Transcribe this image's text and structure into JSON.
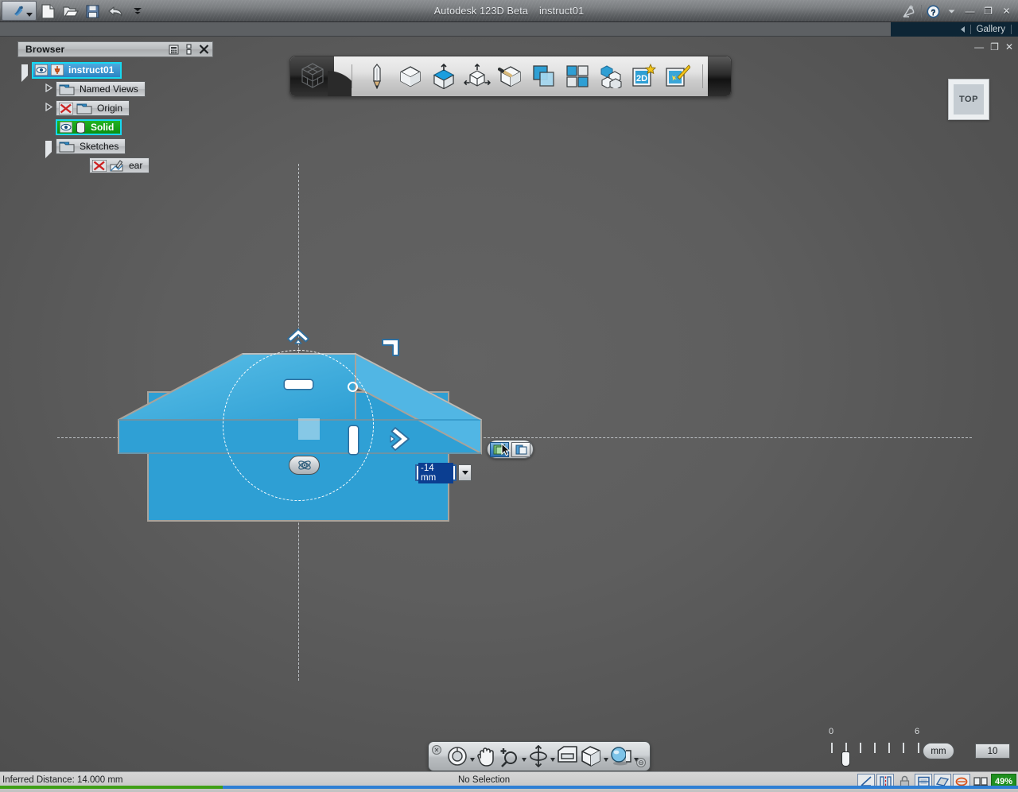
{
  "window": {
    "app_title": "Autodesk 123D Beta",
    "document_name": "instruct01",
    "app_button_icon": "autodesk-logo-icon",
    "app_button_caret_icon": "chevron-down-icon",
    "quick_access": [
      {
        "name": "new-document",
        "icon": "new-file-icon"
      },
      {
        "name": "open-document",
        "icon": "open-folder-icon"
      },
      {
        "name": "save-document",
        "icon": "floppy-disk-icon"
      },
      {
        "name": "undo",
        "icon": "undo-arrow-icon"
      },
      {
        "name": "customize-quick-access",
        "icon": "chevron-down-icon"
      }
    ],
    "help_icon": "question-mark-icon",
    "signal_icon": "satellite-dish-icon",
    "help_caret_icon": "chevron-down-icon",
    "minimize_label": "—",
    "restore_label": "❐",
    "close_label": "✕"
  },
  "gallery_bar": {
    "label": "Gallery",
    "collapse_icon": "triangle-left-icon"
  },
  "browser": {
    "title": "Browser",
    "header_icons": [
      {
        "name": "filter-icon",
        "glyph": "▒"
      },
      {
        "name": "dock-icon",
        "glyph": "▂"
      },
      {
        "name": "close-panel-icon",
        "glyph": "✕"
      }
    ],
    "panel_buttons": [
      {
        "name": "panel-minimize",
        "glyph": "—"
      },
      {
        "name": "panel-restore",
        "glyph": "❐"
      },
      {
        "name": "panel-close",
        "glyph": "✕"
      }
    ],
    "tree": [
      {
        "label": "instruct01",
        "indent": 0,
        "twisty": "open",
        "state": "selected",
        "icons": [
          "eye-icon",
          "pin-document-icon"
        ]
      },
      {
        "label": "Named Views",
        "indent": 1,
        "twisty": "closed",
        "state": "normal",
        "icons": [
          "folder-icon"
        ]
      },
      {
        "label": "Origin",
        "indent": 1,
        "twisty": "closed",
        "state": "normal",
        "icons": [
          "hidden-x-icon",
          "folder-icon"
        ]
      },
      {
        "label": "Solid",
        "indent": 1,
        "twisty": "none",
        "state": "visible",
        "icons": [
          "eye-icon",
          "cylinder-icon"
        ]
      },
      {
        "label": "Sketches",
        "indent": 1,
        "twisty": "open",
        "state": "normal",
        "icons": [
          "folder-icon"
        ]
      },
      {
        "label": "ear",
        "indent": 2,
        "twisty": "none",
        "state": "normal",
        "icons": [
          "hidden-x-icon",
          "sketch-pencil-icon"
        ]
      }
    ]
  },
  "toolbar": {
    "brand_icon": "123d-cube-logo-icon",
    "items": [
      {
        "name": "sketch-tool",
        "icon": "pencil-icon"
      },
      {
        "name": "primitives-tool",
        "icon": "white-cube-icon"
      },
      {
        "name": "construct-tool",
        "icon": "extrude-cube-icon"
      },
      {
        "name": "modify-tool",
        "icon": "move-cube-arrows-icon"
      },
      {
        "name": "pattern-tool",
        "icon": "cube-pencil-icon"
      },
      {
        "name": "combine-tool",
        "icon": "overlap-squares-icon"
      },
      {
        "name": "grouping-tool",
        "icon": "four-squares-icon"
      },
      {
        "name": "assemble-tool",
        "icon": "cube-stack-icon"
      },
      {
        "name": "sketch-2d-tool",
        "icon": "2d-star-icon"
      },
      {
        "name": "smart-tool",
        "icon": "magic-wand-icon"
      }
    ]
  },
  "viewport": {
    "view_cube_label": "TOP",
    "gizmo": {
      "name": "move-manipulator",
      "arrow_up_icon": "chevron-up-arrow-icon",
      "arrow_right_icon": "chevron-right-arrow-icon",
      "corner_icon": "plane-corner-icon",
      "pivot_icon": "pivot-origin-icon",
      "bar_h_name": "drag-handle-horizontal",
      "bar_v_name": "drag-handle-vertical",
      "square_name": "plane-drag-square",
      "ring_name": "rotate-ring-handle"
    },
    "value_box": {
      "value": "-14 mm",
      "dropdown_icon": "chevron-down-icon"
    },
    "mini_toolbar": [
      {
        "name": "cut-operation-button",
        "icon": "cut-solid-icon",
        "active": true
      },
      {
        "name": "join-operation-button",
        "icon": "join-solid-icon",
        "active": false
      }
    ],
    "solid_color": "#2e9fd4",
    "solid_edge_color": "#a9a39b"
  },
  "nav_toolbar": {
    "close_glyph": "✕",
    "minimize_glyph": "⊖",
    "items": [
      {
        "name": "orbit-tool",
        "icon": "orbit-circle-icon",
        "has_dropdown": true
      },
      {
        "name": "pan-tool",
        "icon": "hand-icon",
        "has_dropdown": false
      },
      {
        "name": "zoom-tool",
        "icon": "magnifier-plus-icon",
        "has_dropdown": true
      },
      {
        "name": "free-orbit-tool",
        "icon": "free-orbit-icon",
        "has_dropdown": true
      },
      {
        "name": "view-tool",
        "icon": "view-window-icon",
        "has_dropdown": false
      },
      {
        "name": "display-tool",
        "icon": "shaded-cube-icon",
        "has_dropdown": true
      },
      {
        "name": "look-at-tool",
        "icon": "sphere-look-icon",
        "has_dropdown": true
      }
    ]
  },
  "ruler": {
    "labels": [
      "0",
      "6"
    ],
    "snap_value": "1",
    "unit": "mm",
    "grid_value": "10",
    "tick_count": 7
  },
  "status_bar": {
    "message": "Inferred Distance: 14.000 mm",
    "selection": "No Selection",
    "icons": [
      {
        "name": "snap-angle-icon",
        "glyph": "∠",
        "style": "boxed"
      },
      {
        "name": "symmetry-icon",
        "glyph": "⦀",
        "style": "boxed"
      },
      {
        "name": "lock-icon",
        "glyph": "🔒",
        "style": "flat"
      },
      {
        "name": "grid-snap-icon",
        "glyph": "▤",
        "style": "boxed"
      },
      {
        "name": "sketch-plane-icon",
        "glyph": "▱",
        "style": "boxed"
      },
      {
        "name": "orbit-constraint-icon",
        "glyph": "◇",
        "style": "boxed"
      },
      {
        "name": "dual-view-icon",
        "glyph": "▥",
        "style": "flat"
      }
    ],
    "percent_label": "49%",
    "progress_green_width": 280,
    "progress_blue_width": 1000
  }
}
